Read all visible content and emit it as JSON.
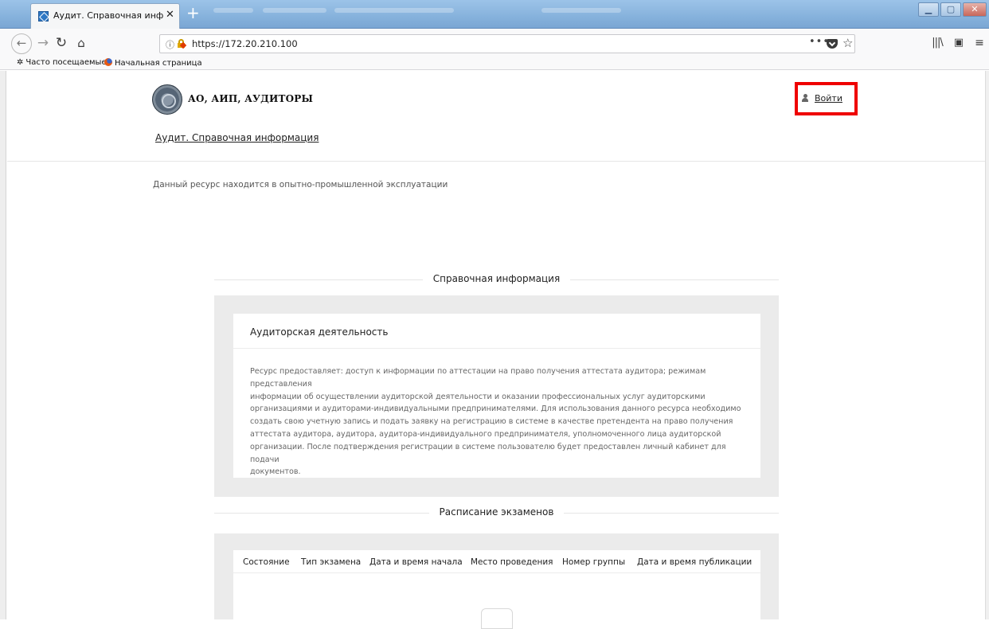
{
  "browser": {
    "tab_title": "Аудит. Справочная информац",
    "url": "https://172.20.210.100",
    "url_info_glyph": "ⓘ",
    "menu_dots": "•••",
    "bookmarks": [
      "Часто посещаемые",
      "Начальная страница"
    ],
    "icons": [
      "back-icon",
      "forward-icon",
      "reload-icon",
      "home-icon",
      "info-icon",
      "lock-warning-icon",
      "pocket-icon",
      "star-icon",
      "library-icon",
      "sidebar-icon",
      "menu-icon",
      "gear-icon",
      "firefox-icon"
    ]
  },
  "header": {
    "org_name": "АО, АИП, АУДИТОРЫ",
    "site_link": "Аудит. Справочная информация",
    "login": "Войти"
  },
  "notice": "Данный ресурс находится в опытно-промышленной эксплуатации",
  "info_section": {
    "title": "Справочная информация",
    "card_title": "Аудиторская деятельность",
    "lines": [
      "Ресурс предоставляет: доступ к информации по аттестации на право получения аттестата аудитора; режимам представления",
      "информации об осуществлении аудиторской деятельности и оказании профессиональных услуг аудиторскими",
      "организациями и аудиторами-индивидуальными предпринимателями. Для использования данного ресурса необходимо",
      "создать свою учетную запись и подать заявку на регистрацию в системе в качестве претендента на право получения",
      "аттестата аудитора, аудитора, аудитора-индивидуального предпринимателя, уполномоченного лица аудиторской",
      "организации. После подтверждения регистрации в системе пользователю будет предоставлен личный кабинет для подачи",
      "документов."
    ]
  },
  "exam_section": {
    "title": "Расписание экзаменов",
    "columns": [
      "Состояние",
      "Тип экзамена",
      "Дата и время начала",
      "Место проведения",
      "Номер группы",
      "Дата и время публикации"
    ]
  },
  "colors": {
    "highlight": "#ef0000",
    "panel_bg": "#ebebeb"
  }
}
